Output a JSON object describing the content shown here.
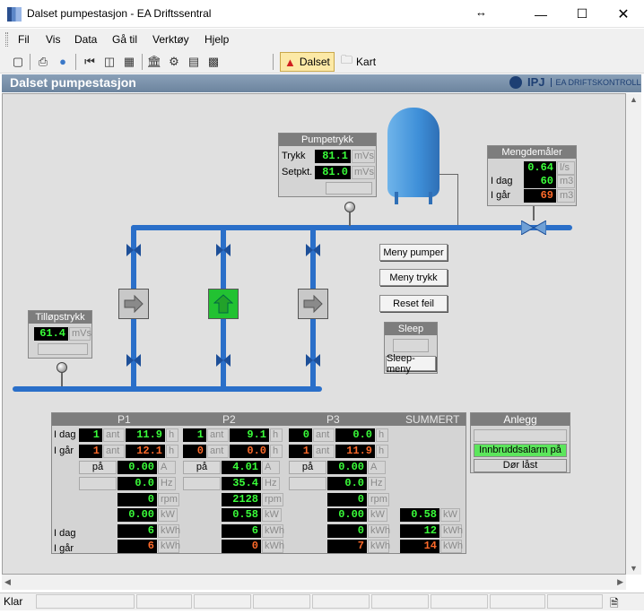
{
  "window": {
    "title": "Dalset pumpestasjon - EA Driftssentral"
  },
  "menu": [
    "Fil",
    "Vis",
    "Data",
    "Gå til",
    "Verktøy",
    "Hjelp"
  ],
  "tabs": {
    "dalset": "Dalset",
    "kart": "Kart"
  },
  "header": {
    "title": "Dalset pumpestasjon",
    "logo_brand": "IPJ",
    "logo_text": "EA DRIFTSKONTROLL"
  },
  "pumpetrykk": {
    "title": "Pumpetrykk",
    "trykk_label": "Trykk",
    "trykk": "81.1",
    "setpkt_label": "Setpkt.",
    "setpkt": "81.0",
    "unit": "mVs"
  },
  "mengde": {
    "title": "Mengdemåler",
    "flow": "0.64",
    "flow_unit": "l/s",
    "idag_label": "I dag",
    "idag": "60",
    "igar_label": "I går",
    "igar": "69",
    "vol_unit": "m3"
  },
  "tillop": {
    "title": "Tilløpstrykk",
    "value": "61.4",
    "unit": "mVs"
  },
  "buttons": {
    "meny_pumper": "Meny pumper",
    "meny_trykk": "Meny trykk",
    "reset_feil": "Reset feil"
  },
  "sleep": {
    "title": "Sleep",
    "menu": "Sleep-meny"
  },
  "table": {
    "headers": {
      "p1": "P1",
      "p2": "P2",
      "p3": "P3",
      "sum": "SUMMERT"
    },
    "row_labels": {
      "idag": "I dag",
      "igar": "I går",
      "kwh_idag": "I dag",
      "kwh_igar": "I går"
    },
    "units": {
      "ant": "ant",
      "h": "h",
      "A": "A",
      "Hz": "Hz",
      "rpm": "rpm",
      "kW": "kW",
      "kWh": "kWh"
    },
    "p1": {
      "idag_ant": "1",
      "idag_h": "11.9",
      "igar_ant": "1",
      "igar_h": "12.1",
      "pa": "på",
      "A": "0.00",
      "Hz": "0.0",
      "rpm": "0",
      "kW": "0.00",
      "kwh_idag": "6",
      "kwh_igar": "6"
    },
    "p2": {
      "idag_ant": "1",
      "idag_h": "9.1",
      "igar_ant": "0",
      "igar_h": "0.0",
      "pa": "på",
      "A": "4.01",
      "Hz": "35.4",
      "rpm": "2128",
      "kW": "0.58",
      "kwh_idag": "6",
      "kwh_igar": "0"
    },
    "p3": {
      "idag_ant": "0",
      "idag_h": "0.0",
      "igar_ant": "1",
      "igar_h": "11.9",
      "pa": "på",
      "A": "0.00",
      "Hz": "0.0",
      "rpm": "0",
      "kW": "0.00",
      "kwh_idag": "0",
      "kwh_igar": "7"
    },
    "sum": {
      "kW": "0.58",
      "kwh_idag": "12",
      "kwh_igar": "14"
    }
  },
  "anlegg": {
    "title": "Anlegg",
    "alarm": "Innbruddsalarm på",
    "dor": "Dør låst"
  },
  "status": {
    "text": "Klar"
  },
  "colors": {
    "pipe": "#2a6fc9",
    "value_green": "#3aff3a",
    "value_orange": "#ff6a2a",
    "alarm_green": "#5ce65c",
    "pump_active": "#22c232"
  }
}
